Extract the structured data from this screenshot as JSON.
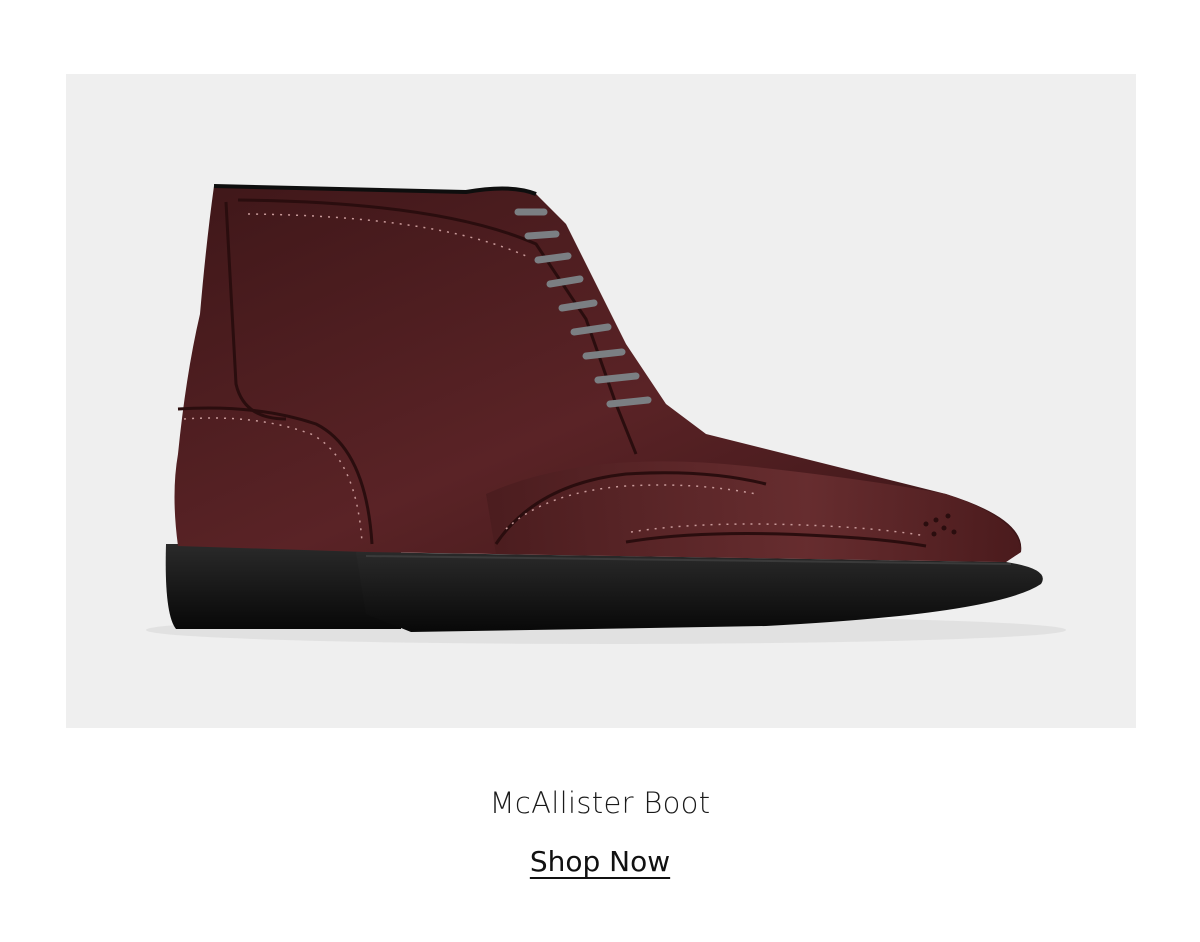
{
  "product": {
    "name": "McAllister Boot",
    "cta_label": "Shop Now",
    "image_icon": "brown-wingtip-boot-image",
    "colors": {
      "panel_background": "#efefef",
      "leather": "#4a1d1f",
      "leather_light": "#6e3336",
      "sole": "#111111",
      "laces": "#7b7f83"
    }
  }
}
